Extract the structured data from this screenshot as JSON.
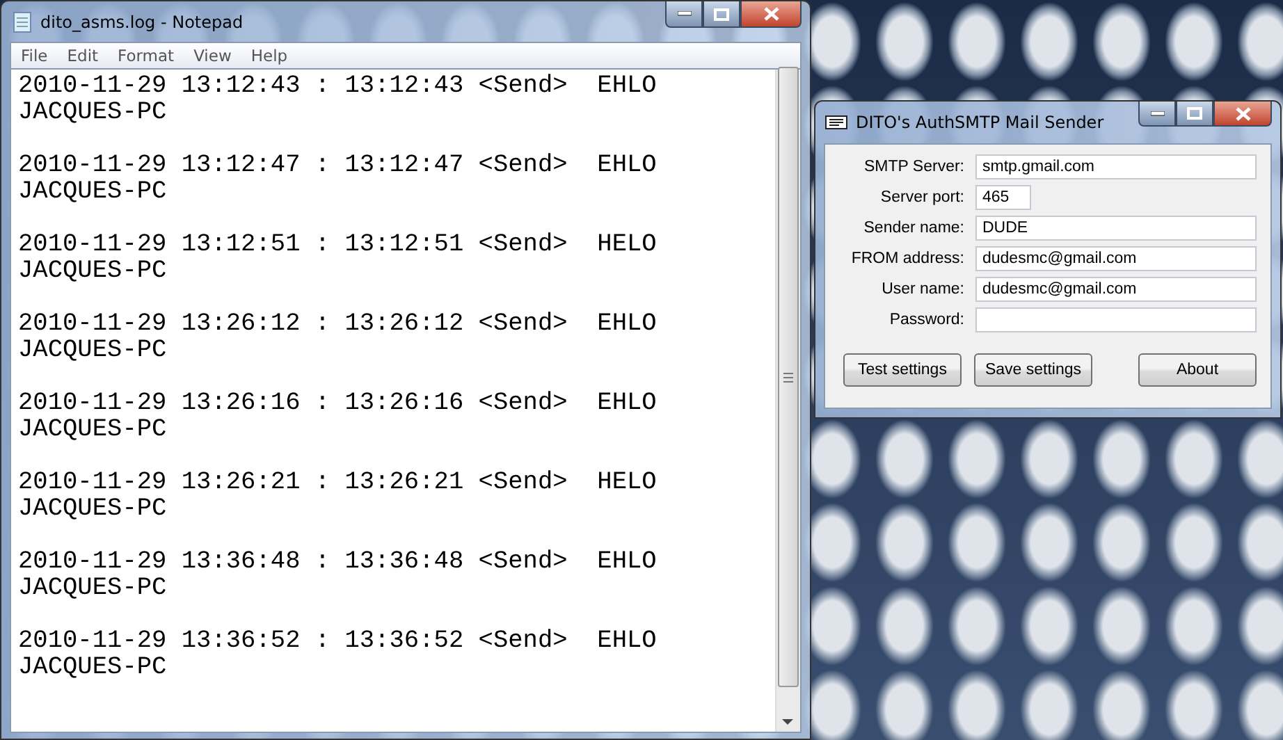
{
  "notepad": {
    "title": "dito_asms.log - Notepad",
    "menu": [
      "File",
      "Edit",
      "Format",
      "View",
      "Help"
    ],
    "entries": [
      {
        "line_1": "2010-11-29 13:12:43 : 13:12:43 <Send>  EHLO",
        "line_2": "JACQUES-PC"
      },
      {
        "line_1": "2010-11-29 13:12:47 : 13:12:47 <Send>  EHLO",
        "line_2": "JACQUES-PC"
      },
      {
        "line_1": "2010-11-29 13:12:51 : 13:12:51 <Send>  HELO",
        "line_2": "JACQUES-PC"
      },
      {
        "line_1": "2010-11-29 13:26:12 : 13:26:12 <Send>  EHLO",
        "line_2": "JACQUES-PC"
      },
      {
        "line_1": "2010-11-29 13:26:16 : 13:26:16 <Send>  EHLO",
        "line_2": "JACQUES-PC"
      },
      {
        "line_1": "2010-11-29 13:26:21 : 13:26:21 <Send>  HELO",
        "line_2": "JACQUES-PC"
      },
      {
        "line_1": "2010-11-29 13:36:48 : 13:36:48 <Send>  EHLO",
        "line_2": "JACQUES-PC"
      },
      {
        "line_1": "2010-11-29 13:36:52 : 13:36:52 <Send>  EHLO",
        "line_2": "JACQUES-PC"
      }
    ]
  },
  "mail_sender": {
    "title": "DITO's AuthSMTP Mail Sender",
    "fields": [
      {
        "label": "SMTP Server:",
        "value": "smtp.gmail.com",
        "kind": "wide"
      },
      {
        "label": "Server port:",
        "value": "465",
        "kind": "short"
      },
      {
        "label": "Sender name:",
        "value": "DUDE",
        "kind": "wide"
      },
      {
        "label": "FROM address:",
        "value": "dudesmc@gmail.com",
        "kind": "wide"
      },
      {
        "label": "User name:",
        "value": "dudesmc@gmail.com",
        "kind": "wide"
      },
      {
        "label": "Password:",
        "kind": "wide"
      }
    ],
    "buttons": [
      "Test settings",
      "Save settings",
      "About"
    ]
  }
}
